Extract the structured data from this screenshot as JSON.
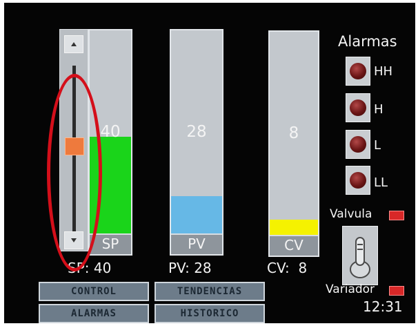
{
  "colors": {
    "sp_fill": "#1ad41a",
    "pv_fill": "#66b8e6",
    "cv_fill": "#f5f200",
    "alarm_led": "#7a1a1a",
    "indicator": "#d82828",
    "annotation_ring": "#d40f1a"
  },
  "bars": [
    {
      "tag": "SP",
      "value": "40",
      "readout": "SP: 40",
      "fill_percent": 40
    },
    {
      "tag": "PV",
      "value": "28",
      "readout": "PV: 28",
      "fill_percent": 20
    },
    {
      "tag": "CV",
      "value": "8",
      "readout": "CV:  8",
      "fill_percent": 8
    }
  ],
  "slider": {
    "level_percent": 40
  },
  "alarms": {
    "title": "Alarmas",
    "items": [
      {
        "label": "HH",
        "icon": "alarm-led-icon"
      },
      {
        "label": "H",
        "icon": "alarm-led-icon"
      },
      {
        "label": "L",
        "icon": "alarm-led-icon"
      },
      {
        "label": "LL",
        "icon": "alarm-led-icon"
      }
    ]
  },
  "valve": {
    "label": "Valvula"
  },
  "drive": {
    "label": "Variador"
  },
  "clock": "12:31",
  "nav_buttons": {
    "control": "CONTROL",
    "trends": "TENDENCIAS",
    "alarms": "ALARMAS",
    "history": "HISTORICO"
  }
}
